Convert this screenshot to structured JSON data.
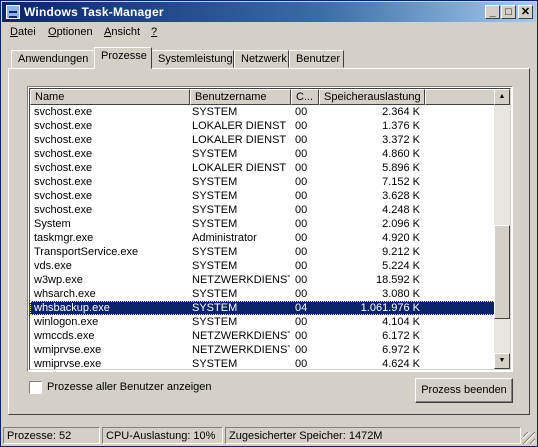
{
  "window": {
    "title": "Windows Task-Manager",
    "controls": {
      "minimize": "_",
      "maximize": "□",
      "close": "✕"
    }
  },
  "menu": {
    "items": [
      {
        "label": "Datei",
        "underline": "D"
      },
      {
        "label": "Optionen",
        "underline": "O"
      },
      {
        "label": "Ansicht",
        "underline": "A"
      },
      {
        "label": "?",
        "underline": "?"
      }
    ]
  },
  "tabs": [
    {
      "label": "Anwendungen",
      "active": false
    },
    {
      "label": "Prozesse",
      "active": true
    },
    {
      "label": "Systemleistung",
      "active": false
    },
    {
      "label": "Netzwerk",
      "active": false
    },
    {
      "label": "Benutzer",
      "active": false
    }
  ],
  "table": {
    "headers": {
      "name": "Name",
      "user": "Benutzername",
      "cpu": "C...",
      "mem": "Speicherauslastung"
    },
    "rows": [
      {
        "name": "svchost.exe",
        "user": "SYSTEM",
        "cpu": "00",
        "mem": "2.364 K"
      },
      {
        "name": "svchost.exe",
        "user": "LOKALER DIENST",
        "cpu": "00",
        "mem": "1.376 K"
      },
      {
        "name": "svchost.exe",
        "user": "LOKALER DIENST",
        "cpu": "00",
        "mem": "3.372 K"
      },
      {
        "name": "svchost.exe",
        "user": "SYSTEM",
        "cpu": "00",
        "mem": "4.860 K"
      },
      {
        "name": "svchost.exe",
        "user": "LOKALER DIENST",
        "cpu": "00",
        "mem": "5.896 K"
      },
      {
        "name": "svchost.exe",
        "user": "SYSTEM",
        "cpu": "00",
        "mem": "7.152 K"
      },
      {
        "name": "svchost.exe",
        "user": "SYSTEM",
        "cpu": "00",
        "mem": "3.628 K"
      },
      {
        "name": "svchost.exe",
        "user": "SYSTEM",
        "cpu": "00",
        "mem": "4.248 K"
      },
      {
        "name": "System",
        "user": "SYSTEM",
        "cpu": "00",
        "mem": "2.096 K"
      },
      {
        "name": "taskmgr.exe",
        "user": "Administrator",
        "cpu": "00",
        "mem": "4.920 K"
      },
      {
        "name": "TransportService.exe",
        "user": "SYSTEM",
        "cpu": "00",
        "mem": "9.212 K"
      },
      {
        "name": "vds.exe",
        "user": "SYSTEM",
        "cpu": "00",
        "mem": "5.224 K"
      },
      {
        "name": "w3wp.exe",
        "user": "NETZWERKDIENST",
        "cpu": "00",
        "mem": "18.592 K"
      },
      {
        "name": "whsarch.exe",
        "user": "SYSTEM",
        "cpu": "00",
        "mem": "3.080 K"
      },
      {
        "name": "whsbackup.exe",
        "user": "SYSTEM",
        "cpu": "04",
        "mem": "1.061.976 K",
        "selected": true
      },
      {
        "name": "winlogon.exe",
        "user": "SYSTEM",
        "cpu": "00",
        "mem": "4.104 K"
      },
      {
        "name": "wmccds.exe",
        "user": "NETZWERKDIENST",
        "cpu": "00",
        "mem": "6.172 K"
      },
      {
        "name": "wmiprvse.exe",
        "user": "NETZWERKDIENST",
        "cpu": "00",
        "mem": "6.972 K"
      },
      {
        "name": "wmiprvse.exe",
        "user": "SYSTEM",
        "cpu": "00",
        "mem": "4.624 K"
      }
    ],
    "scrollbar": {
      "up": "▲",
      "down": "▼",
      "position": 0.78,
      "visible_fraction": 0.38
    }
  },
  "show_all_users": {
    "label": "Prozesse aller Benutzer anzeigen",
    "checked": false
  },
  "end_process_button": "Prozess beenden",
  "status": {
    "processes": "Prozesse: 52",
    "cpu": "CPU-Auslastung: 10%",
    "commit": "Zugesicherter Speicher: 1472M"
  }
}
